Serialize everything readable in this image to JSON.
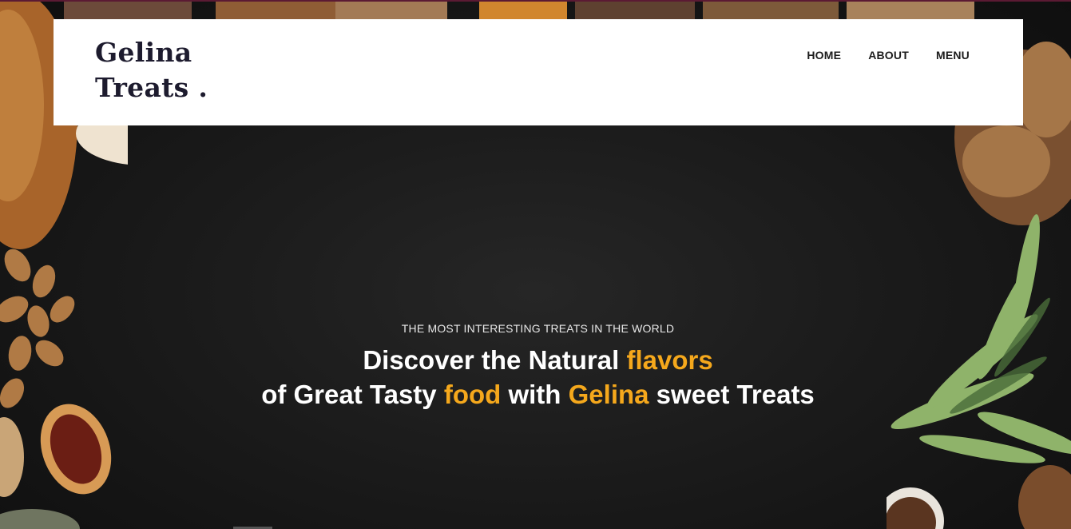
{
  "brand": {
    "line1": "Gelina",
    "line2": "Treats ."
  },
  "nav": {
    "items": [
      "HOME",
      "ABOUT",
      "MENU"
    ]
  },
  "hero": {
    "kicker": "THE MOST INTERESTING TREATS IN THE WORLD",
    "line1_a": "Discover the Natural",
    "line1_accent": "flavors",
    "line2_a": "of Great Tasty",
    "line2_accent1": "food",
    "line2_b": "with",
    "line2_accent2": "Gelina",
    "line2_c": "sweet Treats"
  },
  "colors": {
    "accent": "#f5a81c",
    "background": "#1a1a1a",
    "header_bg": "#ffffff",
    "logo_text": "#1d1b2e"
  }
}
